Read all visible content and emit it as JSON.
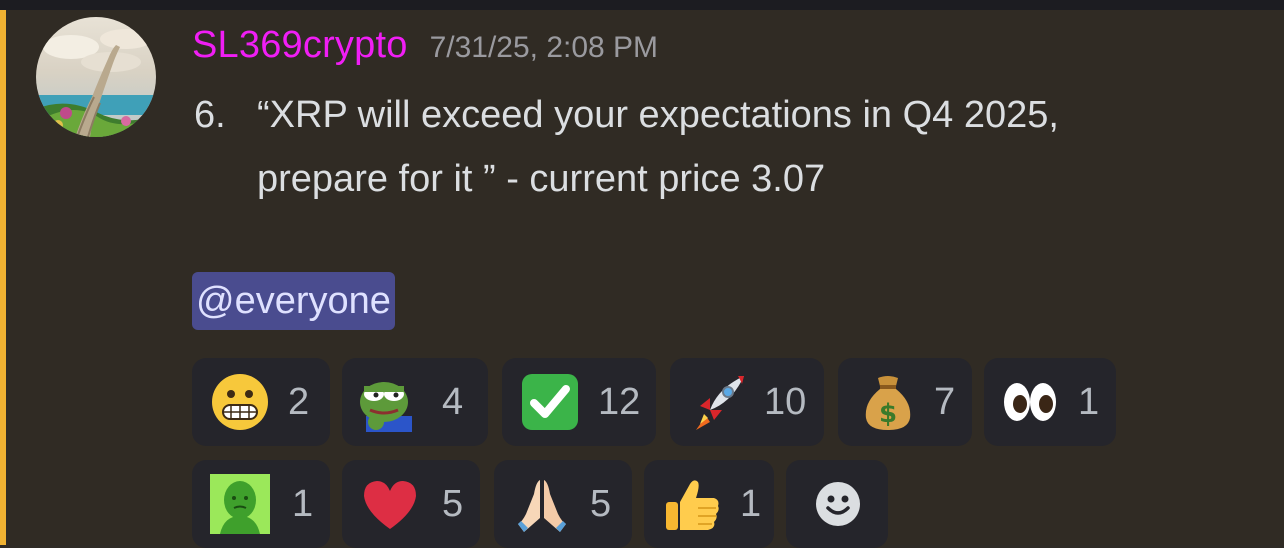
{
  "message": {
    "author": "SL369crypto",
    "timestamp": "7/31/25, 2:08 PM",
    "list_number": "6.",
    "content_line1": "“XRP will exceed your expectations in Q4 2025,",
    "content_line2": "prepare for it ” - current price 3.07",
    "mention": "@everyone"
  },
  "colors": {
    "username": "#f01ef5",
    "mention_bg": "#4a4c8f",
    "highlight_bar": "#f0b232"
  },
  "reactions": [
    {
      "icon": "grimacing-face-icon",
      "count": "2"
    },
    {
      "icon": "pepe-frog-icon",
      "count": "4"
    },
    {
      "icon": "check-mark-button-icon",
      "count": "12"
    },
    {
      "icon": "rocket-icon",
      "count": "10"
    },
    {
      "icon": "money-bag-icon",
      "count": "7"
    },
    {
      "icon": "eyes-icon",
      "count": "1"
    },
    {
      "icon": "green-wojak-icon",
      "count": "1"
    },
    {
      "icon": "red-heart-icon",
      "count": "5"
    },
    {
      "icon": "folded-hands-icon",
      "count": "5"
    },
    {
      "icon": "thumbs-up-icon",
      "count": "1"
    }
  ],
  "add_reaction": {
    "icon": "add-reaction-smiley-icon"
  }
}
